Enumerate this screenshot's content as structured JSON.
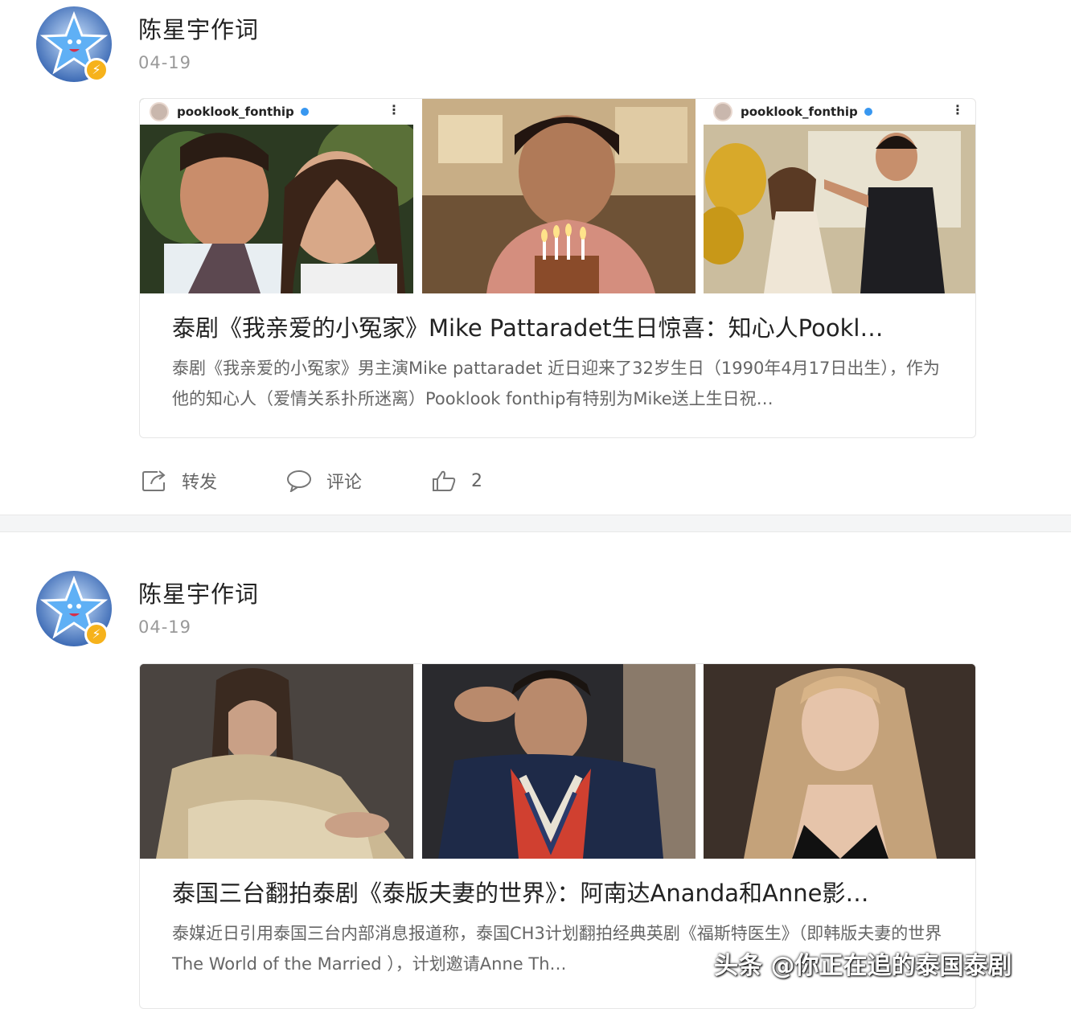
{
  "posts": [
    {
      "author": "陈星宇作词",
      "date": "04-19",
      "images": [
        {
          "ig_user": "pooklook_fonthip",
          "desc": "couple selfie"
        },
        {
          "desc": "man blowing birthday candles"
        },
        {
          "ig_user": "pooklook_fonthip",
          "desc": "couple at birthday party"
        }
      ],
      "title": "泰剧《我亲爱的小冤家》Mike Pattaradet生日惊喜：知心人Pookl…",
      "desc": "泰剧《我亲爱的小冤家》男主演Mike pattaradet 近日迎来了32岁生日（1990年4月17日出生），作为他的知心人（爱情关系扑所迷离）Pooklook fonthip有特别为Mike送上生日祝…",
      "actions": {
        "forward": "转发",
        "comment": "评论",
        "like_count": "2"
      }
    },
    {
      "author": "陈星宇作词",
      "date": "04-19",
      "images": [
        {
          "desc": "woman in gold jacket"
        },
        {
          "desc": "man in striped sweater"
        },
        {
          "desc": "woman with long blonde hair"
        }
      ],
      "title": "泰国三台翻拍泰剧《泰版夫妻的世界》：阿南达Ananda和Anne影…",
      "desc": "泰媒近日引用泰国三台内部消息报道称，泰国CH3计划翻拍经典英剧《福斯特医生》（即韩版夫妻的世界 The World of the Married ），计划邀请Anne Th…"
    }
  ],
  "watermark": "头条 @你正在追的泰国泰剧",
  "colors": {
    "badge": "#f6b21b",
    "divider": "#f4f5f6",
    "muted": "#999999"
  },
  "icons": [
    "forward-icon",
    "comment-icon",
    "like-icon",
    "verified-badge-icon"
  ]
}
